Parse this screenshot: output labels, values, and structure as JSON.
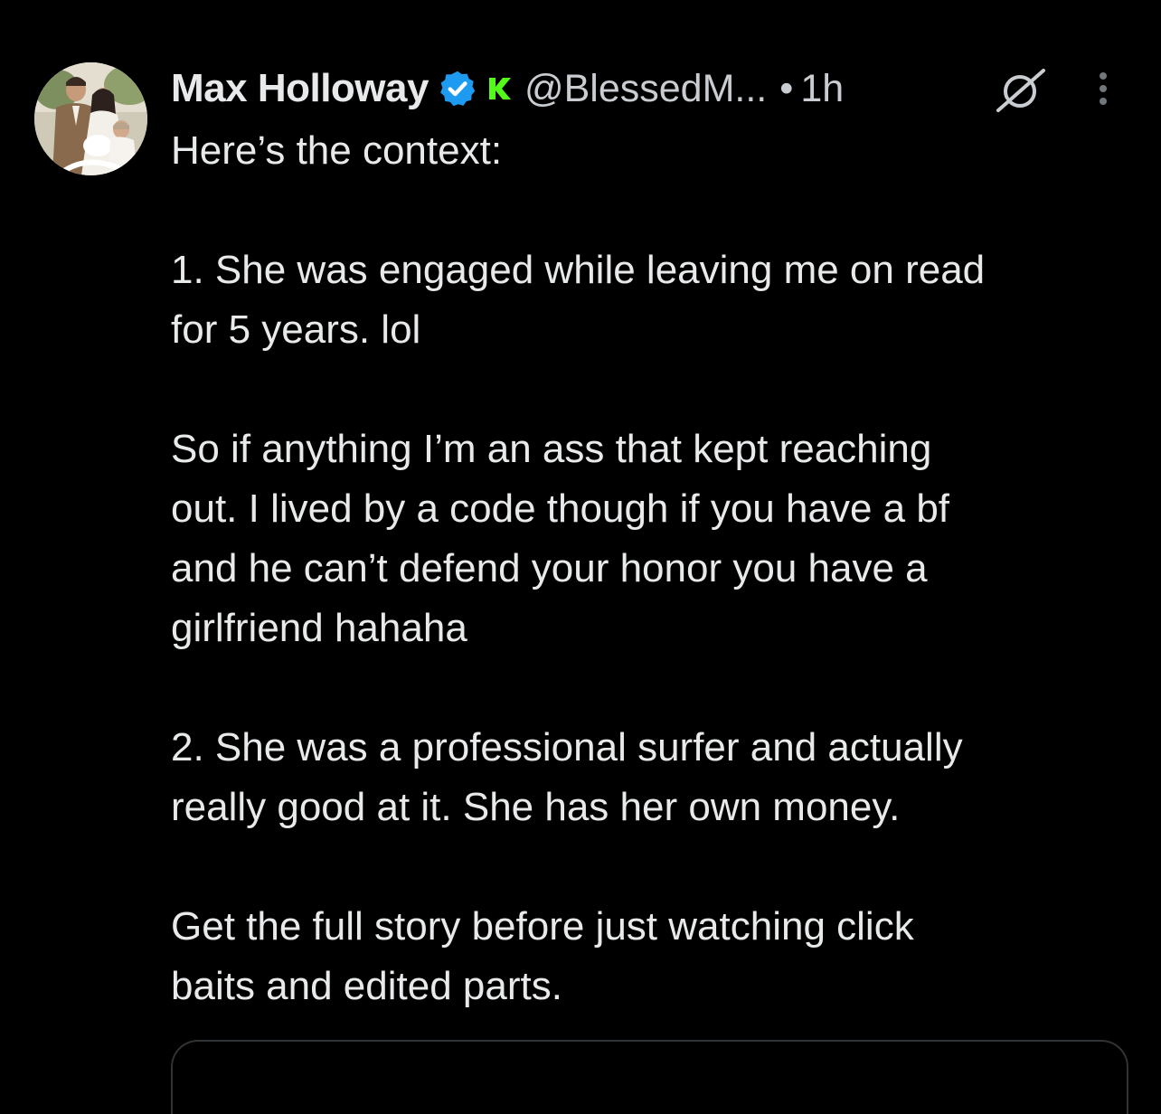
{
  "tweet": {
    "author": {
      "display_name": "Max Holloway",
      "handle": "@BlessedM...",
      "verified": true,
      "affiliate_icon": "k-affiliate-icon"
    },
    "timestamp": "1h",
    "separator": "•",
    "paragraphs": [
      "Here’s the context:",
      "1. She was engaged while leaving me on read\nfor 5 years. lol",
      "So if anything I’m an ass that kept reaching\nout. I lived by a code though if you have a bf\nand he can’t defend your honor you have a\ngirlfriend hahaha",
      "2. She was a professional surfer and actually\nreally good at it. She has her own money.",
      "Get the full story before just watching click\nbaits and edited parts."
    ]
  },
  "icons": {
    "verified": "verified-badge-icon",
    "grok": "grok-icon",
    "more": "more-vertical-icon"
  },
  "colors": {
    "background": "#000000",
    "text": "#e7e9ea",
    "secondary_text": "#c9cdd1",
    "verified_blue": "#1d9bf0",
    "affiliate_green": "#53fc18",
    "divider": "#2f3336"
  }
}
